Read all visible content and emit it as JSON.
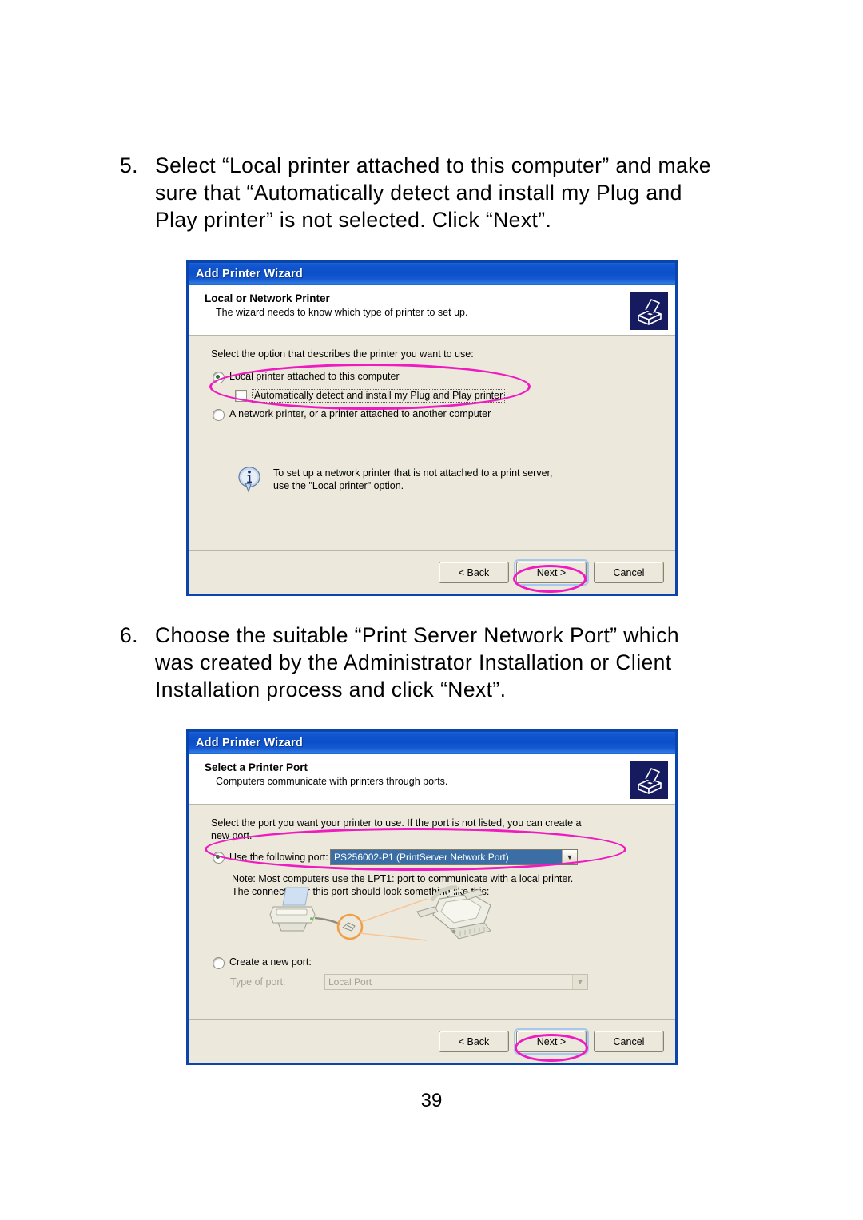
{
  "page": {
    "number": "39"
  },
  "steps": [
    {
      "number": "5.",
      "text": "Select “Local printer attached to this computer” and make sure that “Automatically detect and install my Plug and Play printer” is not selected. Click “Next”."
    },
    {
      "number": "6.",
      "text": "Choose the suitable “Print Server Network Port” which was created by the Administrator Installation or Client Installation process and click “Next”."
    }
  ],
  "colors": {
    "highlight_pink": "#EF1AC0",
    "titlebar_blue": "#0B4FC9",
    "dialog_body": "#ECE9DC",
    "selection_blue": "#3A6EA5",
    "icon_navy": "#151B5E"
  },
  "wizard1": {
    "title": "Add Printer Wizard",
    "header_title": "Local or Network Printer",
    "header_subtitle": "The wizard needs to know which type of printer to set up.",
    "header_icon": "printer-icon",
    "prompt": "Select the option that describes the printer you want to use:",
    "options": [
      {
        "label": "Local printer attached to this computer",
        "type": "radio",
        "selected": true
      },
      {
        "label": "Automatically detect and install my Plug and Play printer",
        "type": "checkbox",
        "selected": false
      },
      {
        "label": "A network printer, or a printer attached to another computer",
        "type": "radio",
        "selected": false
      }
    ],
    "note_icon": "info-icon",
    "note_line1": "To set up a network printer that is not attached to a print server,",
    "note_line2": "use the \"Local printer\" option.",
    "buttons": {
      "back": "< Back",
      "next": "Next >",
      "cancel": "Cancel"
    }
  },
  "wizard2": {
    "title": "Add Printer Wizard",
    "header_title": "Select a Printer Port",
    "header_subtitle": "Computers communicate with printers through ports.",
    "header_icon": "printer-icon",
    "prompt_line1": "Select the port you want your printer to use.  If the port is not listed, you can create a",
    "prompt_line2": "new port.",
    "use_existing_label": "Use the following port:",
    "selected_port": "PS256002-P1 (PrintServer Network Port)",
    "note_line1": "Note: Most computers use the LPT1: port to communicate with a local printer.",
    "note_line2": "The connector for this port should look something like this:",
    "illustration": "printer-to-parallel-connector-diagram",
    "create_new_label": "Create a new port:",
    "type_of_port_label": "Type of port:",
    "type_of_port_value": "Local Port",
    "buttons": {
      "back": "< Back",
      "next": "Next >",
      "cancel": "Cancel"
    }
  }
}
